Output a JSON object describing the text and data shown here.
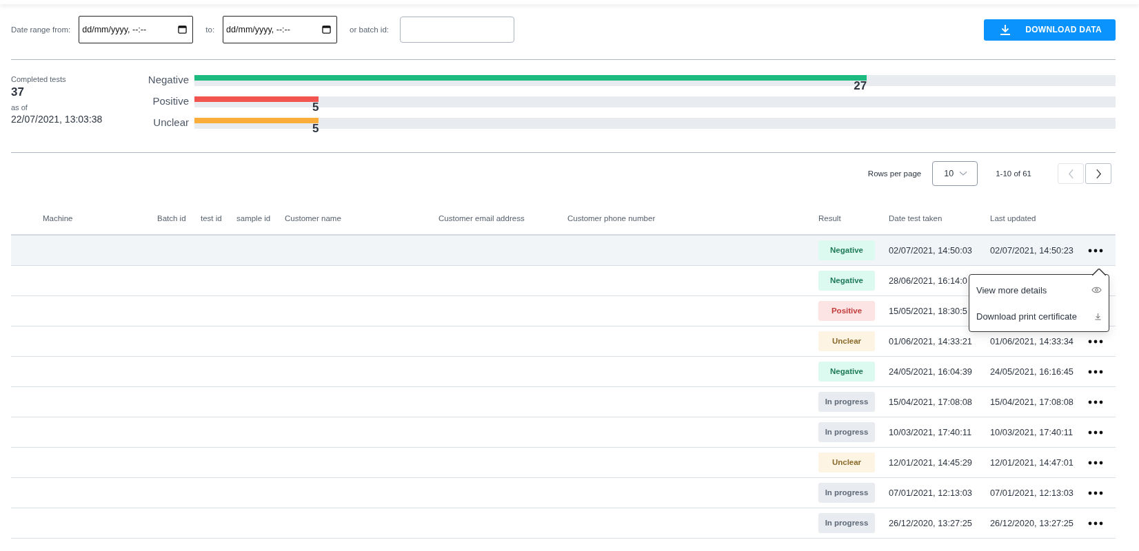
{
  "filters": {
    "from": {
      "label": "Date range from:",
      "placeholder": "dd/mm/yyyy, --:--"
    },
    "to": {
      "label": "to:",
      "placeholder": "dd/mm/yyyy, --:--"
    },
    "batch": {
      "label": "or batch id:"
    },
    "download_button": "DOWNLOAD DATA"
  },
  "summary": {
    "title": "Completed tests",
    "total": "37",
    "as_of_label": "as of",
    "as_of": "22/07/2021, 13:03:38",
    "bars": [
      {
        "label": "Negative",
        "count": "27",
        "level": 0.73,
        "color": "#1dbb80"
      },
      {
        "label": "Positive",
        "count": "5",
        "level": 0.135,
        "color": "#f25450"
      },
      {
        "label": "Unclear",
        "count": "5",
        "level": 0.135,
        "color": "#fbae3c"
      }
    ]
  },
  "pagination": {
    "rows_per_page_label": "Rows per page",
    "rows_per_page": "10",
    "range": "1-10 of 61",
    "prev_disabled": true,
    "next_disabled": false
  },
  "table": {
    "columns": [
      "Machine",
      "Batch id",
      "test id",
      "sample id",
      "Customer name",
      "Customer email address",
      "Customer phone number",
      "Result",
      "Date test taken",
      "Last updated"
    ],
    "rows": [
      {
        "result": {
          "kind": "negative",
          "label": "Negative"
        },
        "date_taken": "02/07/2021, 14:50:03",
        "last_updated": "02/07/2021, 14:50:23",
        "hovered": true,
        "menu_open": true
      },
      {
        "result": {
          "kind": "negative",
          "label": "Negative"
        },
        "date_taken": "28/06/2021, 16:14:0",
        "hovered": false,
        "menu_open": false
      },
      {
        "result": {
          "kind": "positive",
          "label": "Positive"
        },
        "date_taken": "15/05/2021, 18:30:5",
        "hovered": false,
        "menu_open": false
      },
      {
        "result": {
          "kind": "unclear",
          "label": "Unclear"
        },
        "date_taken": "01/06/2021, 14:33:21",
        "last_updated": "01/06/2021, 14:33:34",
        "hovered": false,
        "menu_open": false
      },
      {
        "result": {
          "kind": "negative",
          "label": "Negative"
        },
        "date_taken": "24/05/2021, 16:04:39",
        "last_updated": "24/05/2021, 16:16:45",
        "hovered": false,
        "menu_open": false
      },
      {
        "result": {
          "kind": "in_progress",
          "label": "In progress"
        },
        "date_taken": "15/04/2021, 17:08:08",
        "last_updated": "15/04/2021, 17:08:08",
        "hovered": false,
        "menu_open": false
      },
      {
        "result": {
          "kind": "in_progress",
          "label": "In progress"
        },
        "date_taken": "10/03/2021, 17:40:11",
        "last_updated": "10/03/2021, 17:40:11",
        "hovered": false,
        "menu_open": false
      },
      {
        "result": {
          "kind": "unclear",
          "label": "Unclear"
        },
        "date_taken": "12/01/2021, 14:45:29",
        "last_updated": "12/01/2021, 14:47:01",
        "hovered": false,
        "menu_open": false
      },
      {
        "result": {
          "kind": "in_progress",
          "label": "In progress"
        },
        "date_taken": "07/01/2021, 12:13:03",
        "last_updated": "07/01/2021, 12:13:03",
        "hovered": false,
        "menu_open": false
      },
      {
        "result": {
          "kind": "in_progress",
          "label": "In progress"
        },
        "date_taken": "26/12/2020, 13:27:25",
        "last_updated": "26/12/2020, 13:27:25",
        "hovered": false,
        "menu_open": false
      }
    ]
  },
  "action_menu": {
    "items": [
      {
        "kind": "view",
        "label": "View more details"
      },
      {
        "kind": "download",
        "label": "Download print certificate"
      }
    ]
  }
}
